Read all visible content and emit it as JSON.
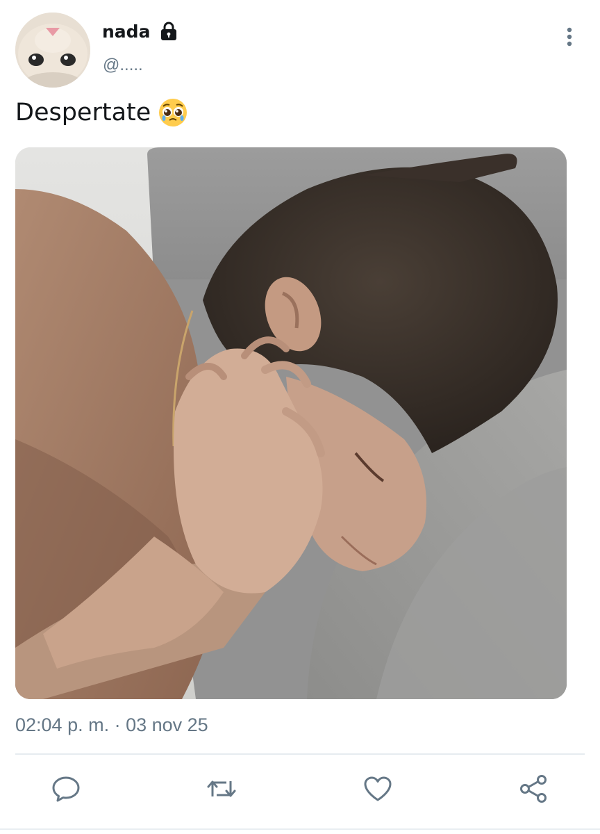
{
  "user": {
    "display_name": "nada",
    "handle": "@.....",
    "protected": true,
    "avatar_icon": "kitten-avatar"
  },
  "tweet": {
    "text": "Despertate",
    "emoji_icon": "pleading-face-emoji",
    "media_description_icon": "photo",
    "timestamp": "02:04 p. m. · 03 nov 25"
  },
  "actions": [
    {
      "name": "reply",
      "icon": "speech-bubble-icon"
    },
    {
      "name": "retweet",
      "icon": "retweet-icon"
    },
    {
      "name": "like",
      "icon": "heart-icon"
    },
    {
      "name": "share",
      "icon": "share-icon"
    }
  ],
  "colors": {
    "text_primary": "#14171a",
    "text_secondary": "#657786",
    "icon_gray": "#657786",
    "divider": "#e6ecf0"
  }
}
